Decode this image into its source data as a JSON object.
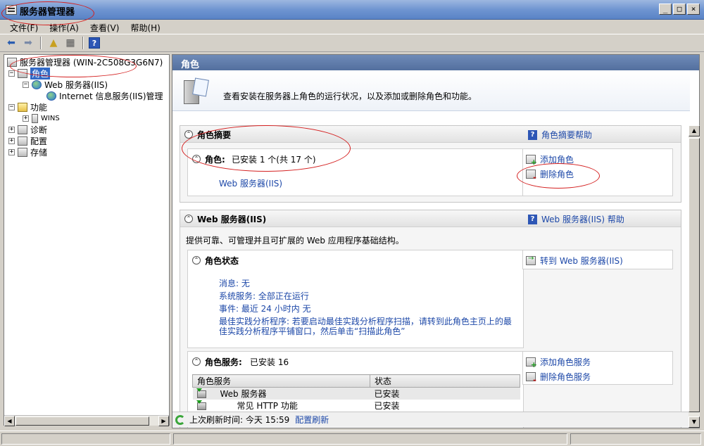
{
  "window": {
    "title": "服务器管理器",
    "buttons": [
      "_",
      "□",
      "×"
    ]
  },
  "menu": {
    "items": [
      "文件(F)",
      "操作(A)",
      "查看(V)",
      "帮助(H)"
    ]
  },
  "toolbar": {
    "help_glyph": "?"
  },
  "tree": {
    "root": "服务器管理器 (WIN-2C508G3G6N7)",
    "roles": "角色",
    "web_server": "Web 服务器(IIS)",
    "iis_manager": "Internet 信息服务(IIS)管理",
    "features": "功能",
    "wins": "WINS",
    "diagnostics": "诊断",
    "configuration": "配置",
    "storage": "存储"
  },
  "main": {
    "header": "角色",
    "intro": "查看安装在服务器上角色的运行状况，以及添加或删除角色和功能。",
    "summary": {
      "title": "角色摘要",
      "help": "角色摘要帮助",
      "roles_label": "角色:",
      "roles_status": "已安装 1 个(共 17 个)",
      "installed_role": "Web 服务器(IIS)",
      "add_role": "添加角色",
      "remove_role": "删除角色"
    },
    "web": {
      "title": "Web 服务器(IIS)",
      "help": "Web 服务器(IIS) 帮助",
      "description": "提供可靠、可管理并且可扩展的 Web 应用程序基础结构。",
      "status_title": "角色状态",
      "goto": "转到 Web 服务器(IIS)",
      "messages": "消息: 无",
      "system_services": "系统服务: 全部正在运行",
      "events": "事件: 最近 24 小时内 无",
      "bpa_line1": "最佳实践分析程序: 若要启动最佳实践分析程序扫描，请转到此角色主页上的最",
      "bpa_line2": "佳实践分析程序平铺窗口，然后单击“扫描此角色”",
      "services_title": "角色服务:",
      "services_status": "已安装 16",
      "add_service": "添加角色服务",
      "remove_service": "删除角色服务",
      "table": {
        "headers": [
          "角色服务",
          "状态"
        ],
        "rows": [
          {
            "name": "Web 服务器",
            "status": "已安装"
          },
          {
            "name": "常见 HTTP 功能",
            "status": "已安装"
          }
        ]
      }
    }
  },
  "refresh": {
    "label": "上次刷新时间: 今天 15:59",
    "config_link": "配置刷新"
  }
}
